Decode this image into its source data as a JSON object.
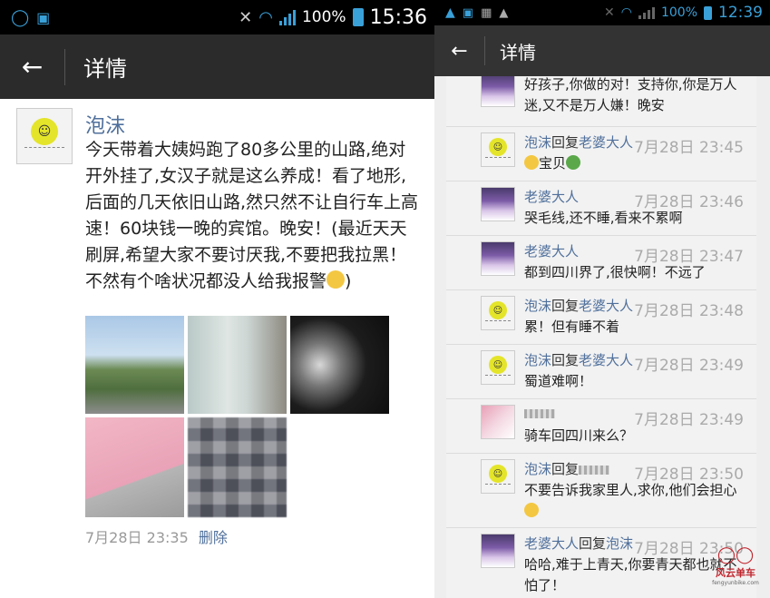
{
  "left": {
    "status": {
      "battery": "100%",
      "time": "15:36"
    },
    "header": {
      "back_label": "←",
      "title": "详情"
    },
    "post": {
      "author": "泡沫",
      "content": "今天带着大姨妈跑了80多公里的山路,绝对开外挂了,女汉子就是这么养成！看了地形,后面的几天依旧山路,然只然不让自行车上高速！60块钱一晚的宾馆。晚安！(最近天天刷屏,希望大家不要讨厌我,不要把我拉黑！不然有个啥状况都没人给我报警",
      "content_end": ")",
      "date": "7月28日",
      "time": "23:35",
      "delete_label": "删除"
    }
  },
  "right": {
    "status": {
      "battery": "100%",
      "time": "12:39"
    },
    "header": {
      "back_label": "←",
      "title": "详情"
    },
    "comments": [
      {
        "author": "老婆大人",
        "reply_word": "",
        "reply_to": "",
        "time": "",
        "text": "好孩子,你做的对！支持你,你是万人迷,又不是万人嫌！晚安",
        "avatar": "girl"
      },
      {
        "author": "泡沫",
        "reply_word": "回复",
        "reply_to": "老婆大人",
        "time": "7月28日 23:45",
        "text": "宝贝",
        "avatar": "smiley"
      },
      {
        "author": "老婆大人",
        "reply_word": "",
        "reply_to": "",
        "time": "7月28日 23:46",
        "text": "哭毛线,还不睡,看来不累啊",
        "avatar": "girl"
      },
      {
        "author": "老婆大人",
        "reply_word": "",
        "reply_to": "",
        "time": "7月28日 23:47",
        "text": "都到四川界了,很快啊！不远了",
        "avatar": "girl"
      },
      {
        "author": "泡沫",
        "reply_word": "回复",
        "reply_to": "老婆大人",
        "time": "7月28日 23:48",
        "text": "累！但有睡不着",
        "avatar": "smiley"
      },
      {
        "author": "泡沫",
        "reply_word": "回复",
        "reply_to": "老婆大人",
        "time": "7月28日 23:49",
        "text": "蜀道难啊！",
        "avatar": "smiley"
      },
      {
        "author": "",
        "reply_word": "",
        "reply_to": "",
        "time": "7月28日 23:49",
        "text": "骑车回四川来么？",
        "avatar": "girl2"
      },
      {
        "author": "泡沫",
        "reply_word": "回复",
        "reply_to": "",
        "time": "7月28日 23:50",
        "text": "不要告诉我家里人,求你,他们会担心",
        "avatar": "smiley"
      },
      {
        "author": "老婆大人",
        "reply_word": "回复",
        "reply_to": "泡沫",
        "time": "7月28日 23:50",
        "text": "哈哈,难于上青天,你要青天都也就不怕了！",
        "avatar": "girl"
      }
    ],
    "watermark": {
      "name": "风云单车",
      "url": "fengyunbike.com"
    }
  },
  "icons": {
    "back": "back-arrow-icon",
    "wifi": "wifi-icon",
    "signal": "signal-icon",
    "battery": "battery-icon",
    "mute": "mute-icon"
  }
}
